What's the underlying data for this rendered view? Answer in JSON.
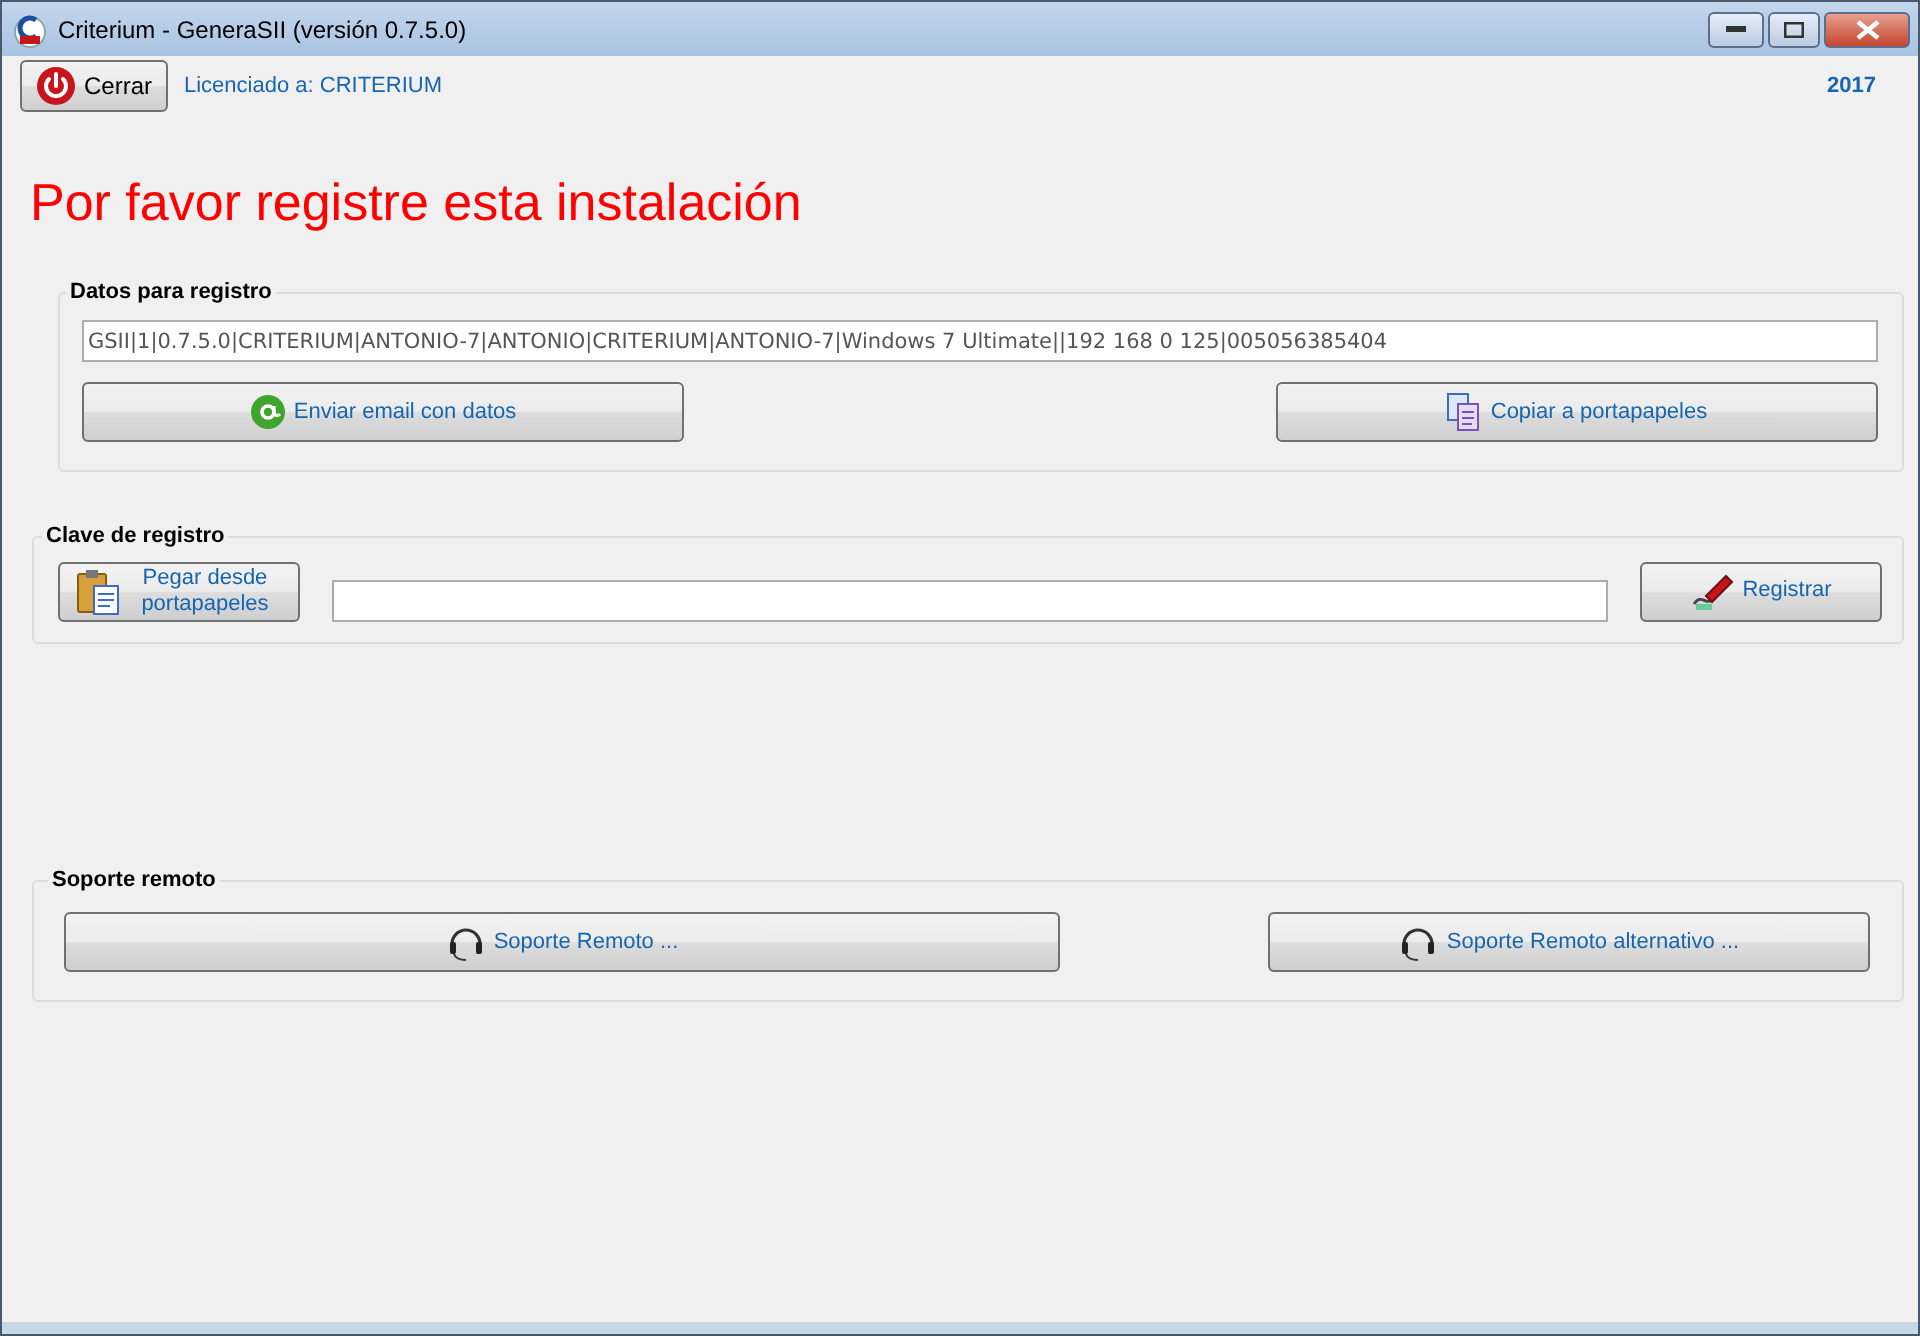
{
  "window": {
    "title": "Criterium - GeneraSII (versión 0.7.5.0)"
  },
  "toolbar": {
    "close_button": "Cerrar",
    "license": "Licenciado a: CRITERIUM",
    "year": "2017"
  },
  "heading": "Por favor registre esta instalación",
  "registration_data": {
    "title": "Datos para registro",
    "value": "GSII|1|0.7.5.0|CRITERIUM|ANTONIO-7|ANTONIO|CRITERIUM|ANTONIO-7|Windows 7 Ultimate||192 168 0 125|005056385404",
    "email_button": "Enviar email con datos",
    "copy_button": "Copiar a portapapeles"
  },
  "registration_key": {
    "title": "Clave de registro",
    "paste_button": "Pegar desde portapapeles",
    "register_button": "Registrar"
  },
  "remote_support": {
    "title": "Soporte remoto",
    "buttons": [
      "Soporte Remoto ...",
      "Soporte Remoto alternativo ..."
    ]
  }
}
